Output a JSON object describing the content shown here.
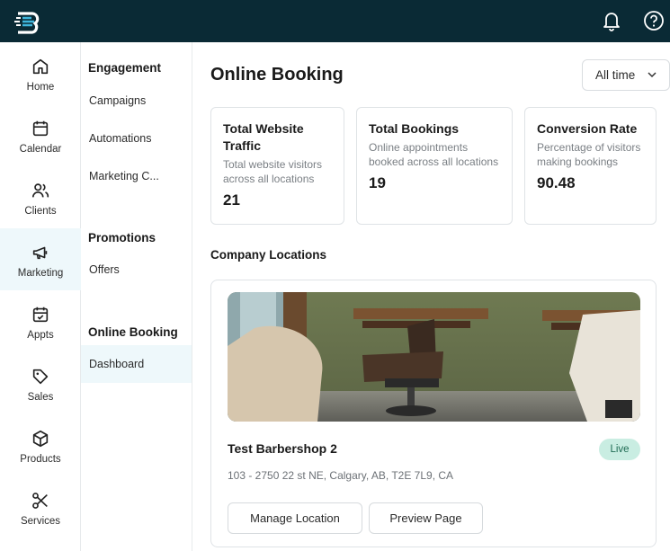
{
  "nav": {
    "items": [
      {
        "label": "Home",
        "icon": "home-icon"
      },
      {
        "label": "Calendar",
        "icon": "calendar-icon"
      },
      {
        "label": "Clients",
        "icon": "clients-icon"
      },
      {
        "label": "Marketing",
        "icon": "megaphone-icon",
        "active": true
      },
      {
        "label": "Appts",
        "icon": "calendar-check-icon"
      },
      {
        "label": "Sales",
        "icon": "tag-icon"
      },
      {
        "label": "Products",
        "icon": "box-icon"
      },
      {
        "label": "Services",
        "icon": "scissors-icon"
      }
    ]
  },
  "subnav": {
    "engagement_heading": "Engagement",
    "engagement_items": [
      "Campaigns",
      "Automations",
      "Marketing C..."
    ],
    "promotions_heading": "Promotions",
    "promotions_items": [
      "Offers"
    ],
    "booking_heading": "Online Booking",
    "booking_items": [
      "Dashboard"
    ]
  },
  "page": {
    "title": "Online Booking",
    "range": "All time"
  },
  "stats": [
    {
      "title": "Total Website Traffic",
      "desc": "Total website visitors across all locations",
      "value": "21"
    },
    {
      "title": "Total Bookings",
      "desc": "Online appointments booked across all locations",
      "value": "19"
    },
    {
      "title": "Conversion Rate",
      "desc": "Percentage of visitors making bookings",
      "value": "90.48"
    }
  ],
  "locations": {
    "heading": "Company Locations",
    "items": [
      {
        "name": "Test Barbershop 2",
        "status": "Live",
        "address": "103 - 2750 22 st NE, Calgary, AB, T2E 7L9, CA",
        "manage_label": "Manage Location",
        "preview_label": "Preview Page"
      }
    ]
  },
  "colors": {
    "topbar": "#0a2a35",
    "logo_accent": "#3fb6dc",
    "active_bg": "#eef8fb",
    "live_badge_bg": "#c9ede2"
  }
}
